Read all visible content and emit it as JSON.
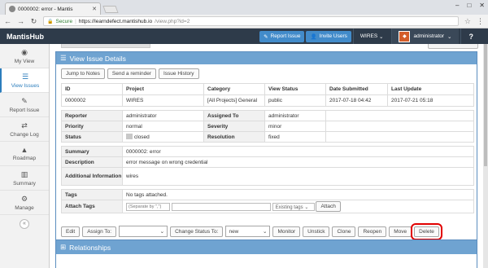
{
  "browser": {
    "tab_title": "0000002: error - Mantis",
    "secure_label": "Secure",
    "url_host": "https://learndefect.mantishub.io",
    "url_path": "/view.php?id=2"
  },
  "navbar": {
    "brand": "MantisHub",
    "report_issue": "Report Issue",
    "invite_users": "Invite Users",
    "project": "WIRES",
    "user": "administrator",
    "help": "?"
  },
  "sidebar": {
    "items": [
      {
        "label": "My View",
        "icon": "dashboard-icon"
      },
      {
        "label": "View Issues",
        "icon": "list-icon"
      },
      {
        "label": "Report Issue",
        "icon": "edit-icon"
      },
      {
        "label": "Change Log",
        "icon": "retweet-icon"
      },
      {
        "label": "Roadmap",
        "icon": "road-icon"
      },
      {
        "label": "Summary",
        "icon": "bar-chart-icon"
      },
      {
        "label": "Manage",
        "icon": "gears-icon"
      }
    ],
    "active": "View Issues"
  },
  "panel": {
    "title": "View Issue Details",
    "buttons": [
      "Jump to Notes",
      "Send a reminder",
      "Issue History"
    ]
  },
  "summary_table": {
    "headers": [
      "ID",
      "Project",
      "Category",
      "View Status",
      "Date Submitted",
      "Last Update"
    ],
    "row": [
      "0000002",
      "WIRES",
      "[All Projects] General",
      "public",
      "2017-07-18 04:42",
      "2017-07-21 05:18"
    ]
  },
  "details": {
    "reporter_label": "Reporter",
    "reporter": "administrator",
    "assigned_label": "Assigned To",
    "assigned": "administrator",
    "priority_label": "Priority",
    "priority": "normal",
    "severity_label": "Severity",
    "severity": "minor",
    "status_label": "Status",
    "status": "closed",
    "resolution_label": "Resolution",
    "resolution": "fixed",
    "summary_label": "Summary",
    "summary": "0000002: error",
    "description_label": "Description",
    "description": "error message on wrong credential",
    "additional_label": "Additional Information",
    "additional": "wires",
    "tags_label": "Tags",
    "tags": "No tags attached.",
    "attach_tags_label": "Attach Tags",
    "attach_tags_placeholder": "(Separate by \",\")",
    "existing_tags": "Existing tags",
    "attach_button": "Attach"
  },
  "actions": {
    "edit": "Edit",
    "assign_to": "Assign To:",
    "change_status": "Change Status To:",
    "status_value": "new",
    "monitor": "Monitor",
    "unstick": "Unstick",
    "clone": "Clone",
    "reopen": "Reopen",
    "move": "Move",
    "delete": "Delete",
    "highlight_color": "#e10000"
  },
  "relationships": {
    "title": "Relationships"
  }
}
